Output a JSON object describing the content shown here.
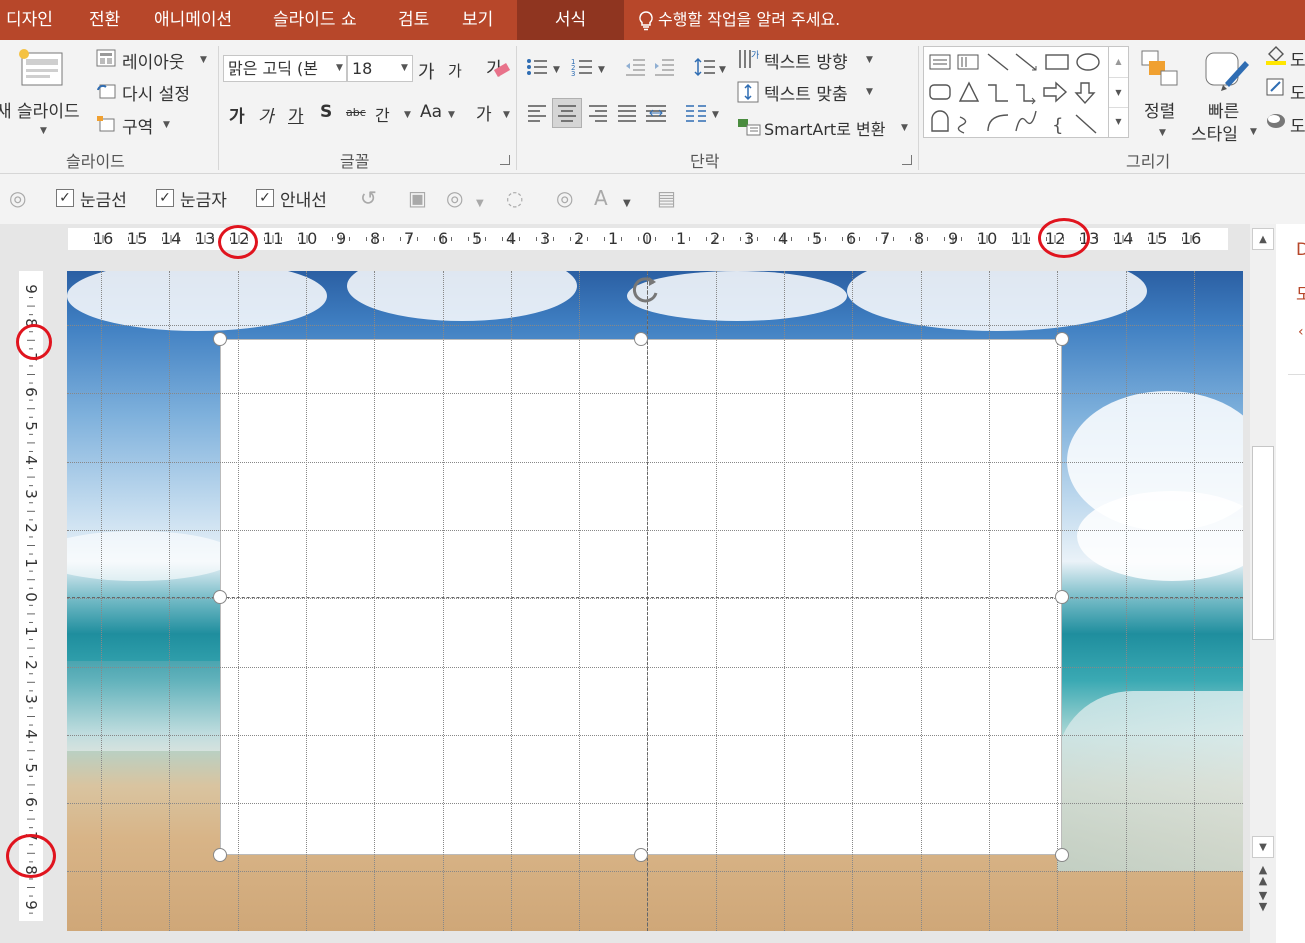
{
  "tabs": [
    {
      "label": "디자인",
      "active": false
    },
    {
      "label": "전환",
      "active": false
    },
    {
      "label": "애니메이션",
      "active": false
    },
    {
      "label": "슬라이드 쇼",
      "active": false
    },
    {
      "label": "검토",
      "active": false
    },
    {
      "label": "보기",
      "active": false
    },
    {
      "label": "서식",
      "active": true
    }
  ],
  "tell_me": "수행할 작업을 알려 주세요.",
  "ribbon": {
    "slides": {
      "new_slide": "새 슬라이드",
      "layout": "레이아웃",
      "reset": "다시 설정",
      "section": "구역",
      "group_label": "슬라이드"
    },
    "font": {
      "font_name": "맑은 고딕 (본",
      "font_size": "18",
      "grow": "가",
      "shrink": "가",
      "clear": "가",
      "bold": "가",
      "italic": "가",
      "underline": "가",
      "shadow": "S",
      "strike": "abc",
      "spacing": "간",
      "case": "Aa",
      "color": "가",
      "group_label": "글꼴"
    },
    "paragraph": {
      "text_direction": "텍스트 방향",
      "align_text": "텍스트 맞춤",
      "smartart": "SmartArt로 변환",
      "group_label": "단락"
    },
    "drawing": {
      "arrange": "정렬",
      "quick_styles_1": "빠른",
      "quick_styles_2": "스타일",
      "right_cut_1": "도",
      "right_cut_2": "도",
      "right_cut_3": "도",
      "group_label": "그리기"
    }
  },
  "drawbar": {
    "gridlines": {
      "label": "눈금선",
      "checked": true
    },
    "ruler": {
      "label": "눈금자",
      "checked": true
    },
    "guides": {
      "label": "안내선",
      "checked": true
    }
  },
  "ruler": {
    "horizontal": [
      "16",
      "15",
      "14",
      "13",
      "12",
      "11",
      "10",
      "9",
      "8",
      "7",
      "6",
      "5",
      "4",
      "3",
      "2",
      "1",
      "0",
      "1",
      "2",
      "3",
      "4",
      "5",
      "6",
      "7",
      "8",
      "9",
      "10",
      "11",
      "12",
      "13",
      "14",
      "15",
      "16"
    ],
    "vertical": [
      "9",
      "8",
      "7",
      "6",
      "5",
      "4",
      "3",
      "2",
      "1",
      "0",
      "1",
      "2",
      "3",
      "4",
      "5",
      "6",
      "7",
      "8",
      "9"
    ]
  },
  "right_pane": {
    "line1": "D",
    "line2": "도"
  },
  "colors": {
    "accent": "#b7472a",
    "active_tab": "#8f3520",
    "highlight_ring": "#e0141e"
  }
}
